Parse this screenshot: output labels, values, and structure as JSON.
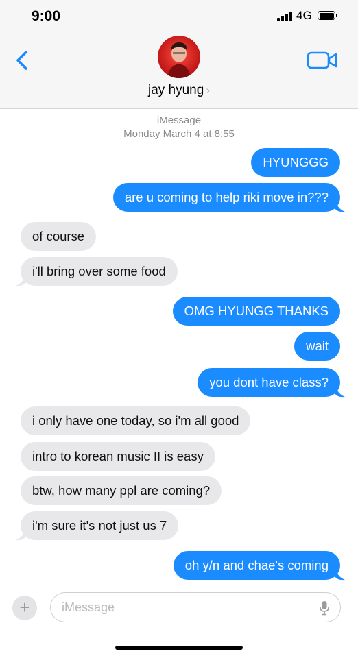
{
  "status": {
    "time": "9:00",
    "network": "4G"
  },
  "contact": {
    "name": "jay hyung",
    "chevron": "›"
  },
  "thread": {
    "service": "iMessage",
    "timestamp": "Monday March 4 at 8:55"
  },
  "messages": [
    {
      "text": "HYUNGGG",
      "dir": "out"
    },
    {
      "text": "are u coming to help riki move in???",
      "dir": "out"
    },
    {
      "text": "of course",
      "dir": "in"
    },
    {
      "text": "i'll bring over some food",
      "dir": "in"
    },
    {
      "text": "OMG HYUNGG THANKS",
      "dir": "out"
    },
    {
      "text": "wait",
      "dir": "out"
    },
    {
      "text": "you dont have class?",
      "dir": "out"
    },
    {
      "text": "i only have one today, so i'm all good",
      "dir": "in"
    },
    {
      "text": "intro to korean music II is easy",
      "dir": "in"
    },
    {
      "text": "btw, how many ppl are coming?",
      "dir": "in"
    },
    {
      "text": "i'm sure it's not just us 7",
      "dir": "in"
    },
    {
      "text": "oh y/n and chae's coming",
      "dir": "out"
    }
  ],
  "composer": {
    "plus": "+",
    "placeholder": "iMessage"
  },
  "colors": {
    "accent": "#1a8cff",
    "incoming": "#e8e8eb",
    "header": "#f6f6f6"
  },
  "icons": [
    "back-chevron-icon",
    "video-camera-icon",
    "plus-icon",
    "microphone-icon",
    "signal-icon",
    "battery-icon"
  ]
}
